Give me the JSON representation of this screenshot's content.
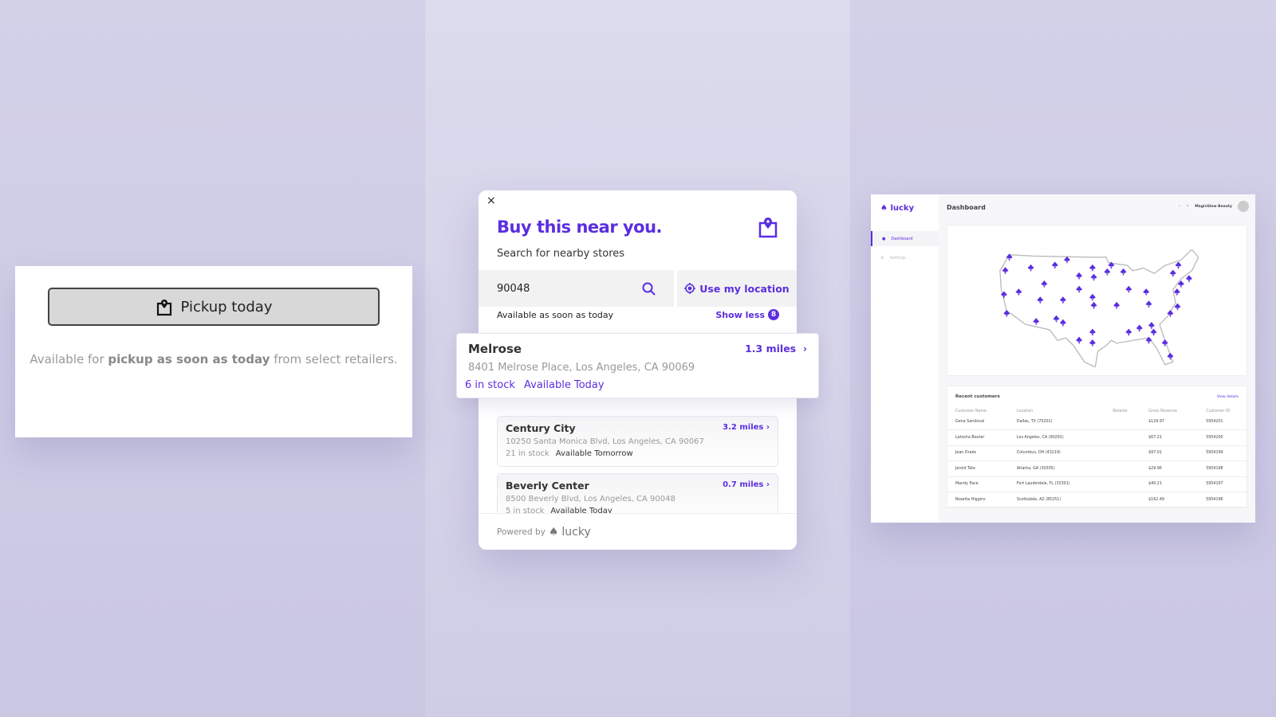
{
  "left_panel": {
    "button_label": "Pickup today",
    "button_icon": "shopping-bag-pin-icon",
    "note_prefix": "Available for ",
    "note_bold": "pickup as soon as today",
    "note_suffix": " from select retailers."
  },
  "modal": {
    "close": "×",
    "title": "Buy this near you.",
    "subtitle": "Search for nearby stores",
    "zip_value": "90048",
    "use_location": "Use my location",
    "availability": "Available as soon as today",
    "show_less": "Show less",
    "show_less_count": "8",
    "selected_store": {
      "name": "Melrose",
      "distance": "1.3 miles",
      "address": "8401 Melrose Place, Los Angeles, CA 90069",
      "stock": "6 in stock",
      "availability": "Available Today"
    },
    "stores": [
      {
        "name": "Century City",
        "distance": "3.2 miles",
        "address": "10250 Santa Monica Blvd, Los Angeles, CA 90067",
        "stock": "21 in stock",
        "availability": "Available Tomorrow"
      },
      {
        "name": "Beverly Center",
        "distance": "0.7 miles",
        "address": "8500 Beverly Blvd, Los Angeles, CA 90048",
        "stock": "5 in stock",
        "availability": "Available Today"
      }
    ],
    "powered_by": "Powered by",
    "brand": "lucky"
  },
  "dashboard": {
    "logo": "lucky",
    "nav": [
      {
        "label": "Dashboard",
        "active": true
      },
      {
        "label": "Settings",
        "active": false
      }
    ],
    "title": "Dashboard",
    "account": "MagicGlow Beauty",
    "customers": {
      "title": "Recent customers",
      "view_details": "View details",
      "columns": [
        "Customer Name",
        "Location",
        "Retailer",
        "Gross Revenue",
        "Customer ID"
      ],
      "rows": [
        [
          "Gena Sandoval",
          "Dallas, TX (75201)",
          "",
          "$129.97",
          "5954201"
        ],
        [
          "Latosha Baxter",
          "Los Angeles, CA (90291)",
          "",
          "$67.21",
          "5954200"
        ],
        [
          "Jean Drake",
          "Columbus, OH (43219)",
          "",
          "$97.01",
          "5954199"
        ],
        [
          "Jerold Tate",
          "Atlanta, GA (30305)",
          "",
          "$29.96",
          "5954198"
        ],
        [
          "Mandy Pace",
          "Fort Lauderdale, FL (33301)",
          "",
          "$40.21",
          "5954197"
        ],
        [
          "Rosetta Higgins",
          "Scottsdale, AZ (85251)",
          "",
          "$162.49",
          "5954196"
        ]
      ]
    }
  },
  "colors": {
    "accent": "#5b2ee0",
    "background": "#d2d0e7"
  }
}
